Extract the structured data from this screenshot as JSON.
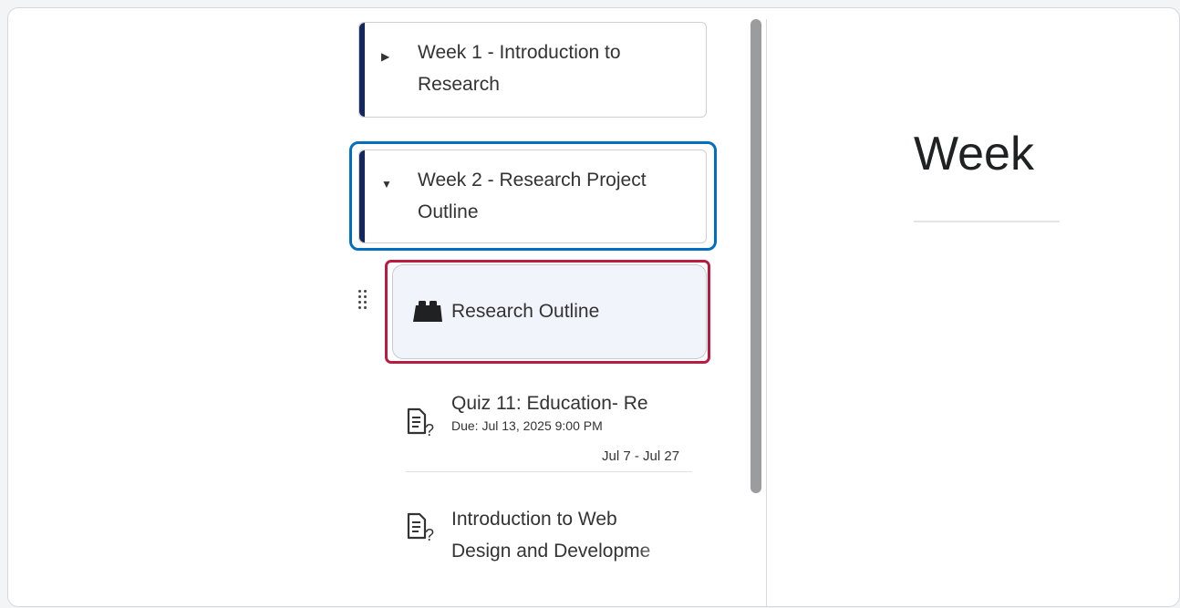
{
  "units": [
    {
      "title": "Week 1 - Introduction to Research",
      "state": "collapsed"
    },
    {
      "title": "Week 2 - Research Project Outline",
      "state": "expanded"
    }
  ],
  "selected_item": {
    "title": "Research Outline",
    "icon": "lego-block-icon"
  },
  "topics": [
    {
      "title": "Quiz 11: Education- Re",
      "due": "Due: Jul 13, 2025 9:00 PM",
      "dates": "Jul 7 - Jul 27",
      "icon": "quiz-icon"
    },
    {
      "title": "Introduction to Web Design and Developme",
      "icon": "quiz-icon"
    }
  ],
  "main": {
    "heading": "Week"
  },
  "colors": {
    "unit_bar": "#13275a",
    "focus_ring": "#006fbf",
    "selected_ring": "#b91c40"
  }
}
